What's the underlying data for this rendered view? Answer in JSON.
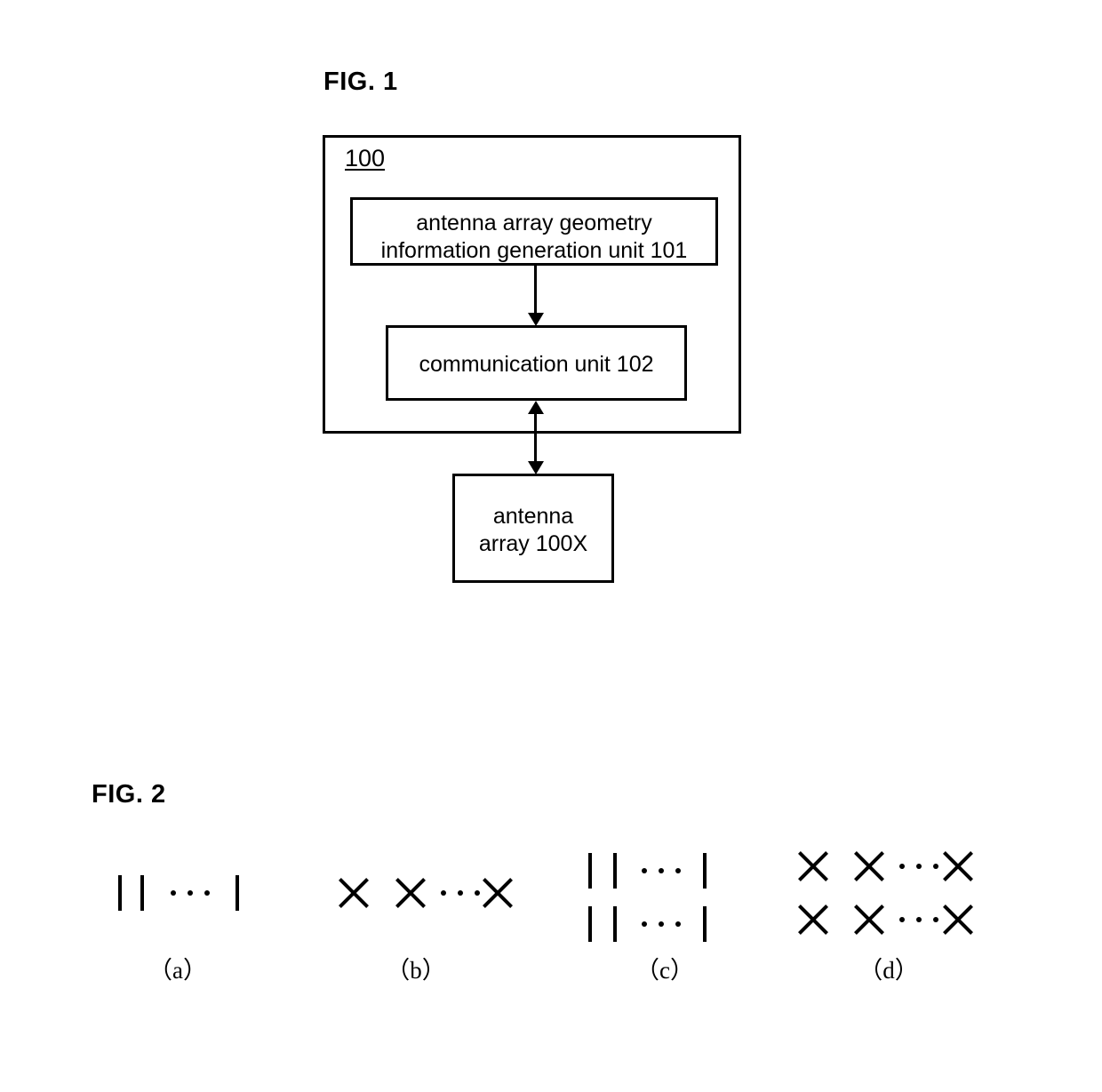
{
  "figures": {
    "fig1": {
      "title": "FIG. 1",
      "outer_box_ref": "100",
      "blocks": [
        {
          "id": "geometry-unit",
          "label": "antenna array geometry\ninformation generation unit 101"
        },
        {
          "id": "communication-unit",
          "label": "communication unit 102"
        },
        {
          "id": "antenna-array",
          "label": "antenna\narray 100X"
        }
      ],
      "connectors": [
        {
          "id": "geometry-to-communication",
          "type": "arrow-down",
          "heads": 1
        },
        {
          "id": "communication-to-antenna-array",
          "type": "arrow-bidirectional",
          "heads": 2
        }
      ]
    },
    "fig2": {
      "title": "FIG. 2",
      "panels": [
        {
          "id": "panel-a",
          "label": "（a）",
          "element_type": "bar",
          "rows": 1,
          "visible_elements_per_row": 3,
          "ellipsis_after_index": 2
        },
        {
          "id": "panel-b",
          "label": "（b）",
          "element_type": "cross",
          "rows": 1,
          "visible_elements_per_row": 3,
          "ellipsis_after_index": 2
        },
        {
          "id": "panel-c",
          "label": "（c）",
          "element_type": "bar",
          "rows": 2,
          "visible_elements_per_row": 3,
          "ellipsis_after_index": 2
        },
        {
          "id": "panel-d",
          "label": "（d）",
          "element_type": "cross",
          "rows": 2,
          "visible_elements_per_row": 3,
          "ellipsis_after_index": 2
        }
      ]
    }
  },
  "colors": {
    "ink": "#000000",
    "paper": "#ffffff"
  }
}
